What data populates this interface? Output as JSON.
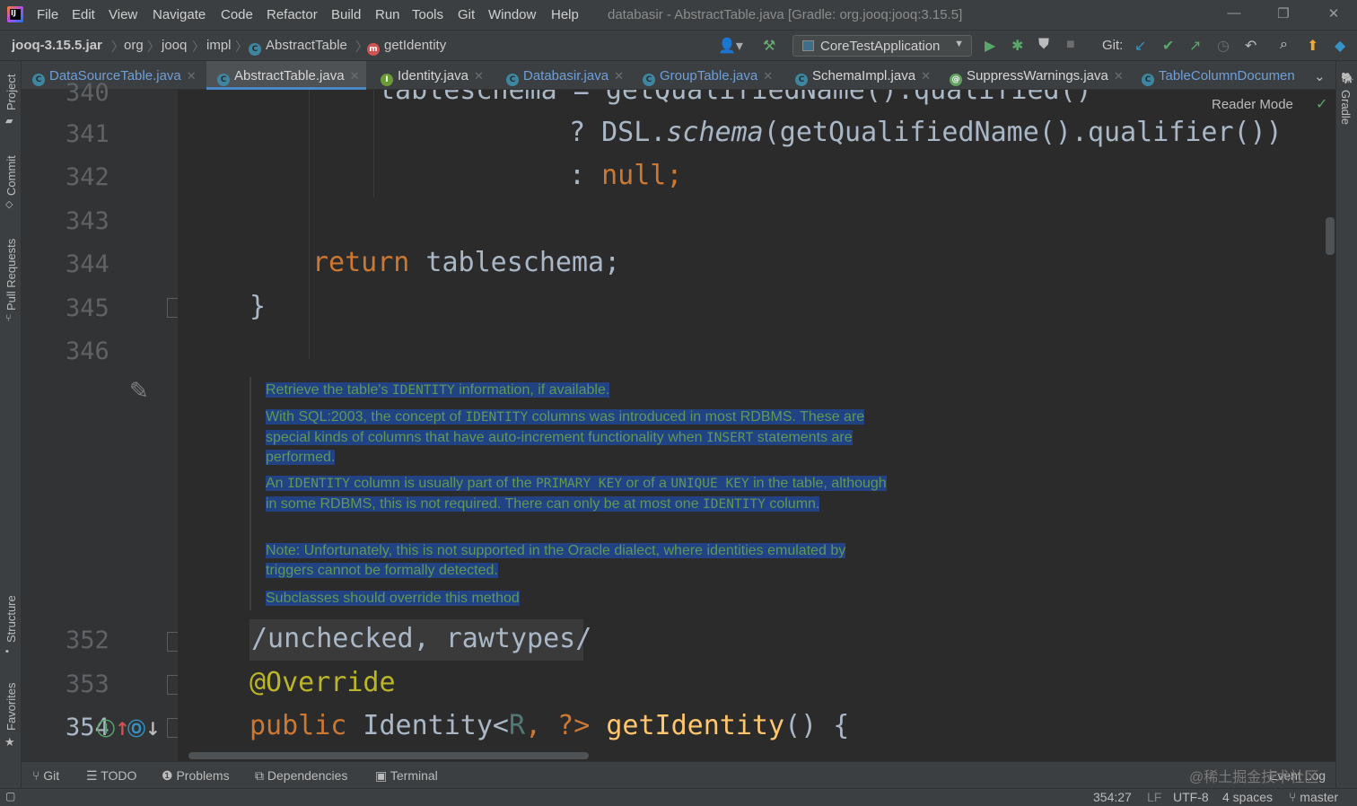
{
  "menubar": {
    "items": [
      "File",
      "Edit",
      "View",
      "Navigate",
      "Code",
      "Refactor",
      "Build",
      "Run",
      "Tools",
      "Git",
      "Window",
      "Help"
    ],
    "title": "databasir - AbstractTable.java [Gradle: org.jooq:jooq:3.15.5]",
    "logo_text": "IJ"
  },
  "navbar": {
    "crumbs": [
      "jooq-3.15.5.jar",
      "org",
      "jooq",
      "impl",
      "AbstractTable",
      "getIdentity"
    ],
    "run_config": "CoreTestApplication",
    "git_label": "Git:"
  },
  "tabs": [
    {
      "label": "DataSourceTable.java",
      "icon": "C"
    },
    {
      "label": "AbstractTable.java",
      "icon": "C",
      "active": true
    },
    {
      "label": "Identity.java",
      "icon": "I"
    },
    {
      "label": "Databasir.java",
      "icon": "C"
    },
    {
      "label": "GroupTable.java",
      "icon": "C"
    },
    {
      "label": "SchemaImpl.java",
      "icon": "C"
    },
    {
      "label": "SuppressWarnings.java",
      "icon": "@"
    },
    {
      "label": "TableColumnDocumen",
      "icon": "C"
    }
  ],
  "side_left": [
    "Project",
    "Commit",
    "Pull Requests",
    "Structure",
    "Favorites"
  ],
  "side_right": [
    "Gradle"
  ],
  "editor": {
    "reader_mode": "Reader Mode",
    "lines": [
      {
        "num": "340",
        "text": "tableschema = getQualifiedName().qualified()"
      },
      {
        "num": "341",
        "q": "?",
        "a": "DSL.",
        "b": "schema",
        "c": "(getQualifiedName().qualifier())"
      },
      {
        "num": "342",
        "q": ":",
        "kw": "null",
        ";": ";"
      },
      {
        "num": "343"
      },
      {
        "num": "344",
        "kw": "return",
        "rest": " tableschema;"
      },
      {
        "num": "345",
        "text": "}"
      },
      {
        "num": "346"
      },
      {
        "num": "352",
        "text": "/unchecked, rawtypes/"
      },
      {
        "num": "353",
        "text": "@Override"
      },
      {
        "num": "354",
        "kw": "public",
        "type": " Identity<",
        "gen": "R",
        "rest": ", ?> ",
        "fn": "getIdentity",
        "end": "() {"
      }
    ],
    "javadoc": {
      "p1": [
        "Retrieve the table's ",
        "IDENTITY",
        " information, if available."
      ],
      "p2": [
        "With SQL:2003, the concept of ",
        "IDENTITY",
        " columns was introduced in most RDBMS. These are special kinds of columns that have auto-increment functionality when ",
        "INSERT",
        " statements are performed."
      ],
      "p3": [
        "An ",
        "IDENTITY",
        " column is usually part of the ",
        "PRIMARY KEY",
        " or of a ",
        "UNIQUE KEY",
        " in the table, although in some RDBMS, this is not required. There can only be at most one ",
        "IDENTITY",
        " column."
      ],
      "p4": "Note: Unfortunately, this is not supported in the Oracle dialect, where identities emulated by triggers cannot be formally detected.",
      "p5": "Subclasses should override this method"
    }
  },
  "bottom_tools": [
    "Git",
    "TODO",
    "Problems",
    "Dependencies",
    "Terminal"
  ],
  "status": {
    "position": "354:27",
    "line_sep": "LF",
    "encoding": "UTF-8",
    "indent": "4 spaces",
    "branch": "master",
    "event_log": "Event Log"
  },
  "watermark": "@稀土掘金技术社区",
  "colors": {
    "keyword": "#cc7832",
    "function": "#ffc66d",
    "annotation": "#bbb529",
    "selection": "#214283",
    "doc_text": "#629755"
  }
}
